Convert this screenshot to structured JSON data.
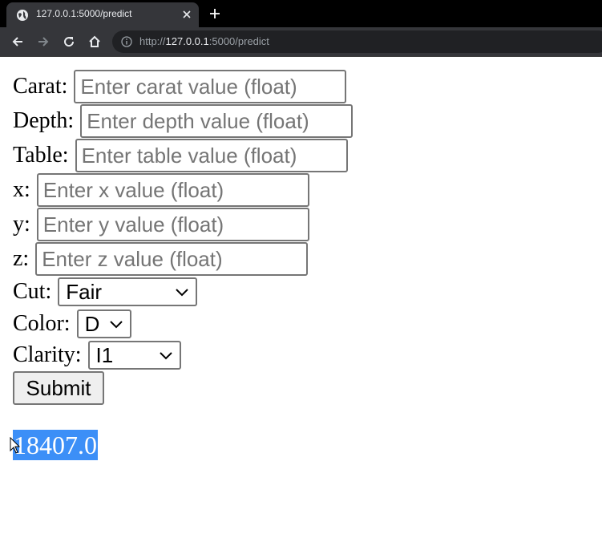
{
  "browser": {
    "tab_title": "127.0.0.1:5000/predict",
    "url_host": "127.0.0.1",
    "url_rest": ":5000/predict",
    "url_scheme": "http://"
  },
  "form": {
    "fields": [
      {
        "label": "Carat:",
        "placeholder": "Enter carat value (float)"
      },
      {
        "label": "Depth:",
        "placeholder": "Enter depth value (float)"
      },
      {
        "label": "Table:",
        "placeholder": "Enter table value (float)"
      },
      {
        "label": "x:",
        "placeholder": "Enter x value (float)"
      },
      {
        "label": "y:",
        "placeholder": "Enter y value (float)"
      },
      {
        "label": "z:",
        "placeholder": "Enter z value (float)"
      }
    ],
    "selects": [
      {
        "label": "Cut:",
        "value": "Fair"
      },
      {
        "label": "Color:",
        "value": "D"
      },
      {
        "label": "Clarity:",
        "value": "I1"
      }
    ],
    "submit_label": "Submit"
  },
  "result": {
    "value": "18407.0",
    "highlight_color": "#3c8ff7"
  }
}
